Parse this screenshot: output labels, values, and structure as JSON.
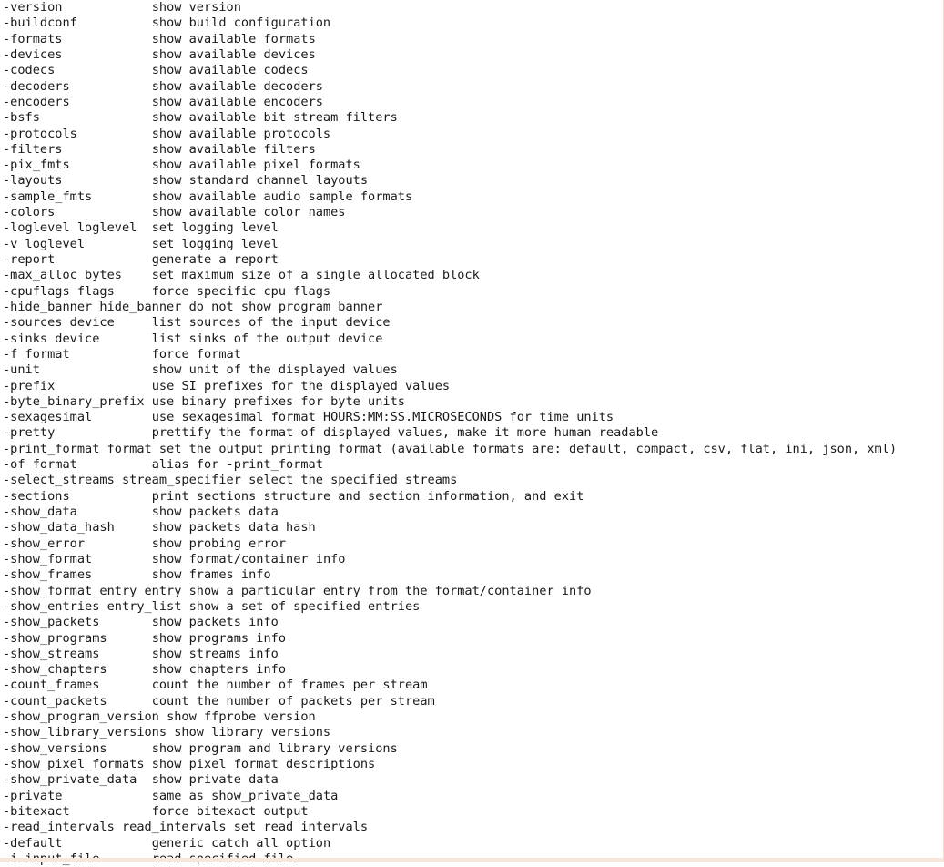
{
  "terminal": {
    "program": "ffprobe",
    "background_color": "#ffffff",
    "text_color": "#191919",
    "border_color": "#f0e2d8",
    "highlight_band_color": "#f8e6dc",
    "option_column_width": 20,
    "lines": [
      {
        "option": "-version",
        "description": "show version"
      },
      {
        "option": "-buildconf",
        "description": "show build configuration"
      },
      {
        "option": "-formats",
        "description": "show available formats"
      },
      {
        "option": "-devices",
        "description": "show available devices"
      },
      {
        "option": "-codecs",
        "description": "show available codecs"
      },
      {
        "option": "-decoders",
        "description": "show available decoders"
      },
      {
        "option": "-encoders",
        "description": "show available encoders"
      },
      {
        "option": "-bsfs",
        "description": "show available bit stream filters"
      },
      {
        "option": "-protocols",
        "description": "show available protocols"
      },
      {
        "option": "-filters",
        "description": "show available filters"
      },
      {
        "option": "-pix_fmts",
        "description": "show available pixel formats"
      },
      {
        "option": "-layouts",
        "description": "show standard channel layouts"
      },
      {
        "option": "-sample_fmts",
        "description": "show available audio sample formats"
      },
      {
        "option": "-colors",
        "description": "show available color names"
      },
      {
        "option": "-loglevel loglevel",
        "description": "set logging level"
      },
      {
        "option": "-v loglevel",
        "description": "set logging level"
      },
      {
        "option": "-report",
        "description": "generate a report"
      },
      {
        "option": "-max_alloc bytes",
        "description": "set maximum size of a single allocated block"
      },
      {
        "option": "-cpuflags flags",
        "description": "force specific cpu flags"
      },
      {
        "option": "-hide_banner hide_banner",
        "description": "do not show program banner"
      },
      {
        "option": "-sources device",
        "description": "list sources of the input device"
      },
      {
        "option": "-sinks device",
        "description": "list sinks of the output device"
      },
      {
        "option": "-f format",
        "description": "force format"
      },
      {
        "option": "-unit",
        "description": "show unit of the displayed values"
      },
      {
        "option": "-prefix",
        "description": "use SI prefixes for the displayed values"
      },
      {
        "option": "-byte_binary_prefix",
        "description": "use binary prefixes for byte units"
      },
      {
        "option": "-sexagesimal",
        "description": "use sexagesimal format HOURS:MM:SS.MICROSECONDS for time units"
      },
      {
        "option": "-pretty",
        "description": "prettify the format of displayed values, make it more human readable"
      },
      {
        "option": "-print_format format",
        "description": "set the output printing format (available formats are: default, compact, csv, flat, ini, json, xml)"
      },
      {
        "option": "-of format",
        "description": "alias for -print_format"
      },
      {
        "option": "-select_streams stream_specifier",
        "description": "select the specified streams"
      },
      {
        "option": "-sections",
        "description": "print sections structure and section information, and exit"
      },
      {
        "option": "-show_data",
        "description": "show packets data"
      },
      {
        "option": "-show_data_hash",
        "description": "show packets data hash"
      },
      {
        "option": "-show_error",
        "description": "show probing error"
      },
      {
        "option": "-show_format",
        "description": "show format/container info"
      },
      {
        "option": "-show_frames",
        "description": "show frames info"
      },
      {
        "option": "-show_format_entry entry",
        "description": "show a particular entry from the format/container info"
      },
      {
        "option": "-show_entries entry_list",
        "description": "show a set of specified entries"
      },
      {
        "option": "-show_packets",
        "description": "show packets info"
      },
      {
        "option": "-show_programs",
        "description": "show programs info"
      },
      {
        "option": "-show_streams",
        "description": "show streams info"
      },
      {
        "option": "-show_chapters",
        "description": "show chapters info"
      },
      {
        "option": "-count_frames",
        "description": "count the number of frames per stream"
      },
      {
        "option": "-count_packets",
        "description": "count the number of packets per stream"
      },
      {
        "option": "-show_program_version",
        "description": "show ffprobe version"
      },
      {
        "option": "-show_library_versions",
        "description": "show library versions"
      },
      {
        "option": "-show_versions",
        "description": "show program and library versions"
      },
      {
        "option": "-show_pixel_formats",
        "description": "show pixel format descriptions"
      },
      {
        "option": "-show_private_data",
        "description": "show private data"
      },
      {
        "option": "-private",
        "description": "same as show_private_data"
      },
      {
        "option": "-bitexact",
        "description": "force bitexact output"
      },
      {
        "option": "-read_intervals read_intervals",
        "description": "set read intervals"
      },
      {
        "option": "-default",
        "description": "generic catch all option"
      },
      {
        "option": "-i input_file",
        "description": "read specified file"
      }
    ]
  }
}
